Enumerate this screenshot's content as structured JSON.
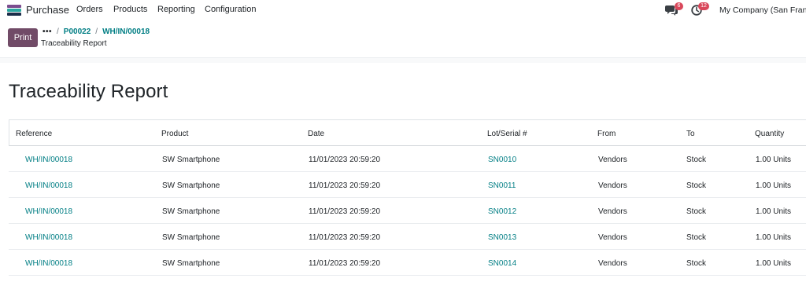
{
  "navbar": {
    "app_name": "Purchase",
    "menus": [
      "Orders",
      "Products",
      "Reporting",
      "Configuration"
    ],
    "chat_badge": "6",
    "activity_badge": "12",
    "company": "My Company (San Franc"
  },
  "control_panel": {
    "print_label": "Print",
    "breadcrumb_dots": "•••",
    "breadcrumb": [
      "P00022",
      "WH/IN/00018"
    ],
    "subtitle": "Traceability Report"
  },
  "report": {
    "title": "Traceability Report",
    "columns": [
      "Reference",
      "Product",
      "Date",
      "Lot/Serial #",
      "From",
      "To",
      "Quantity"
    ],
    "rows": [
      {
        "reference": "WH/IN/00018",
        "product": "SW Smartphone",
        "date": "11/01/2023 20:59:20",
        "lot": "SN0010",
        "from": "Vendors",
        "to": "Stock",
        "quantity": "1.00 Units"
      },
      {
        "reference": "WH/IN/00018",
        "product": "SW Smartphone",
        "date": "11/01/2023 20:59:20",
        "lot": "SN0011",
        "from": "Vendors",
        "to": "Stock",
        "quantity": "1.00 Units"
      },
      {
        "reference": "WH/IN/00018",
        "product": "SW Smartphone",
        "date": "11/01/2023 20:59:20",
        "lot": "SN0012",
        "from": "Vendors",
        "to": "Stock",
        "quantity": "1.00 Units"
      },
      {
        "reference": "WH/IN/00018",
        "product": "SW Smartphone",
        "date": "11/01/2023 20:59:20",
        "lot": "SN0013",
        "from": "Vendors",
        "to": "Stock",
        "quantity": "1.00 Units"
      },
      {
        "reference": "WH/IN/00018",
        "product": "SW Smartphone",
        "date": "11/01/2023 20:59:20",
        "lot": "SN0014",
        "from": "Vendors",
        "to": "Stock",
        "quantity": "1.00 Units"
      }
    ]
  },
  "icons": {
    "app_logo": "purchase-app-icon",
    "chat": "chat-bubbles-icon",
    "activity": "clock-icon"
  },
  "colors": {
    "primary": "#714b67",
    "link": "#017e84",
    "badge": "#d9475a"
  }
}
